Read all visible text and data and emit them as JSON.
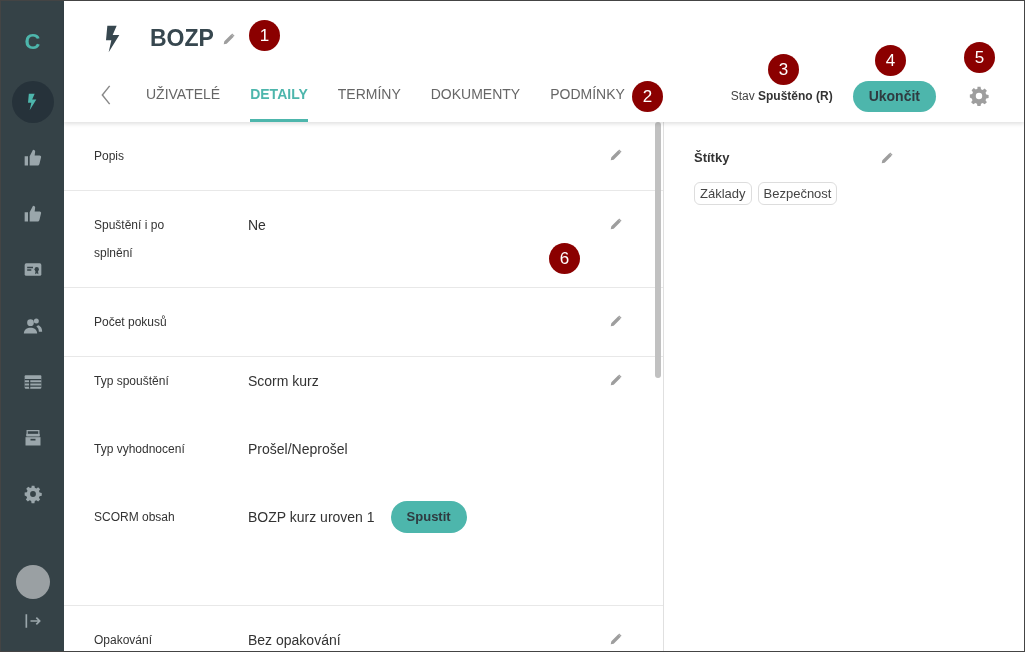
{
  "sidebar": {
    "logo": "C",
    "items": [
      {
        "kind": "bolt",
        "selected": true
      },
      {
        "kind": "thumb",
        "selected": false
      },
      {
        "kind": "thumb",
        "selected": false
      },
      {
        "kind": "certificate",
        "selected": false
      },
      {
        "kind": "users",
        "selected": false
      },
      {
        "kind": "table",
        "selected": false
      },
      {
        "kind": "archive",
        "selected": false
      },
      {
        "kind": "gear",
        "selected": false
      }
    ]
  },
  "header": {
    "title": "BOZP",
    "status_label": "Stav",
    "status_value": "Spuštěno (R)",
    "end_button": "Ukončit",
    "tabs": [
      {
        "label": "UŽIVATELÉ",
        "selected": false
      },
      {
        "label": "DETAILY",
        "selected": true
      },
      {
        "label": "TERMÍNY",
        "selected": false
      },
      {
        "label": "DOKUMENTY",
        "selected": false
      },
      {
        "label": "PODMÍNKY",
        "selected": false
      }
    ]
  },
  "sections": [
    {
      "rows": [
        {
          "label": "Popis"
        }
      ]
    },
    {
      "rows": [
        {
          "label": "Spuštění i po splnění",
          "value": "Ne"
        }
      ]
    },
    {
      "rows": [
        {
          "label": "Počet pokusů"
        }
      ]
    },
    {
      "rows": [
        {
          "label": "Typ spouštění",
          "value": "Scorm kurz"
        },
        {
          "label": "Typ vyhodnocení",
          "value": "Prošel/Neprošel"
        },
        {
          "label": "SCORM obsah",
          "value": "BOZP kurz uroven 1",
          "action": "Spustit"
        }
      ]
    },
    {
      "rows": [
        {
          "label": "Opakování",
          "value": "Bez opakování"
        }
      ]
    }
  ],
  "tags_panel": {
    "title": "Štítky",
    "tags": [
      "Základy",
      "Bezpečnost"
    ]
  },
  "callouts": [
    "1",
    "2",
    "3",
    "4",
    "5",
    "6"
  ]
}
